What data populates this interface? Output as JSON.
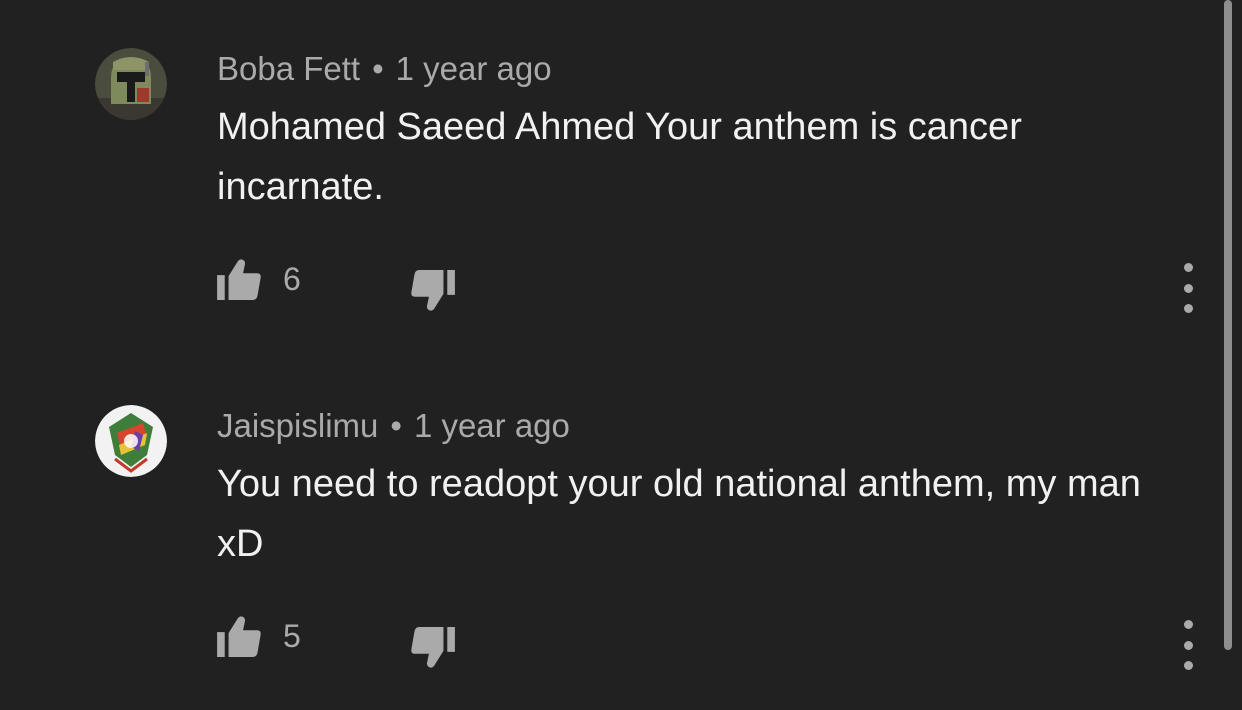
{
  "comments": [
    {
      "author": "Boba Fett",
      "separator": "•",
      "time": "1 year ago",
      "text": "Mohamed Saeed Ahmed Your anthem is cancer incarnate.",
      "likes": "6",
      "avatar_icon": "helmet-avatar-icon"
    },
    {
      "author": "Jaispislimu",
      "separator": "•",
      "time": "1 year ago",
      "text": "You need to readopt your old national anthem, my man xD",
      "likes": "5",
      "avatar_icon": "emblem-avatar-icon"
    }
  ],
  "colors": {
    "background": "#212121",
    "primary_text": "#f1f1f1",
    "secondary_text": "#aaaaaa",
    "icon": "#aaaaaa"
  }
}
